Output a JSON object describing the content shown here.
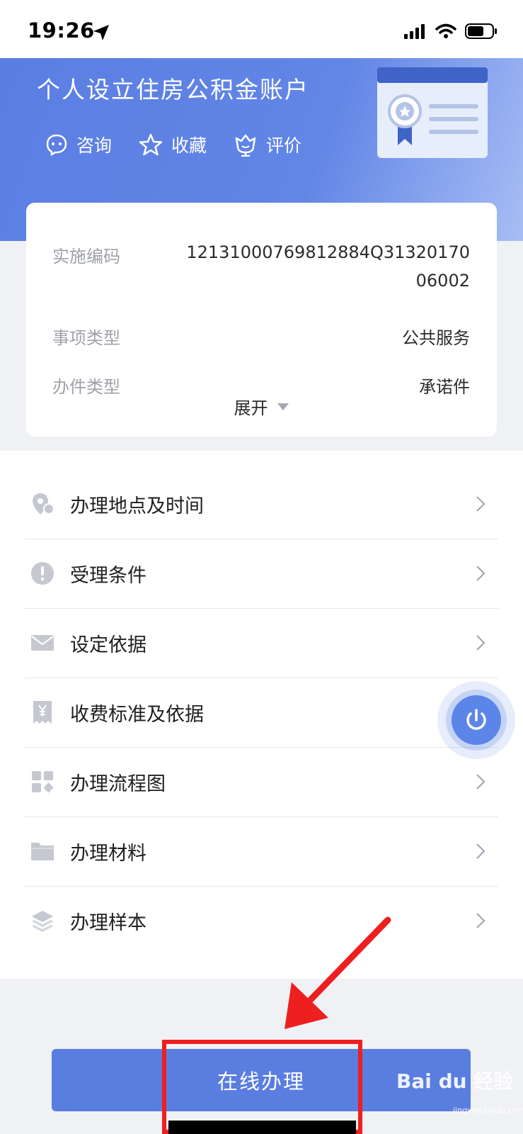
{
  "status_bar": {
    "time": "19:26"
  },
  "header": {
    "title": "个人设立住房公积金账户",
    "actions": [
      {
        "label": "咨询",
        "icon": "chat-icon"
      },
      {
        "label": "收藏",
        "icon": "star-icon"
      },
      {
        "label": "评价",
        "icon": "flower-icon"
      }
    ]
  },
  "info_card": {
    "rows": [
      {
        "label": "实施编码",
        "value_line1": "12131000769812884Q31320170",
        "value_line2": "06002"
      },
      {
        "label": "事项类型",
        "value": "公共服务"
      },
      {
        "label": "办件类型",
        "value": "承诺件"
      }
    ],
    "expand_label": "展开"
  },
  "menu": {
    "items": [
      {
        "label": "办理地点及时间",
        "icon": "location-icon"
      },
      {
        "label": "受理条件",
        "icon": "exclamation-icon"
      },
      {
        "label": "设定依据",
        "icon": "envelope-icon"
      },
      {
        "label": "收费标准及依据",
        "icon": "yen-receipt-icon"
      },
      {
        "label": "办理流程图",
        "icon": "flowchart-icon"
      },
      {
        "label": "办理材料",
        "icon": "folder-icon"
      },
      {
        "label": "办理样本",
        "icon": "layers-icon"
      }
    ]
  },
  "bottom": {
    "apply_label": "在线办理"
  },
  "watermark": {
    "brand": "Bai du 经验",
    "url": "jingyan.baidu.com"
  },
  "colors": {
    "primary": "#5a7de0",
    "header_gradient_end": "#a7bdf4",
    "annotation_red": "#ee1f1f"
  }
}
